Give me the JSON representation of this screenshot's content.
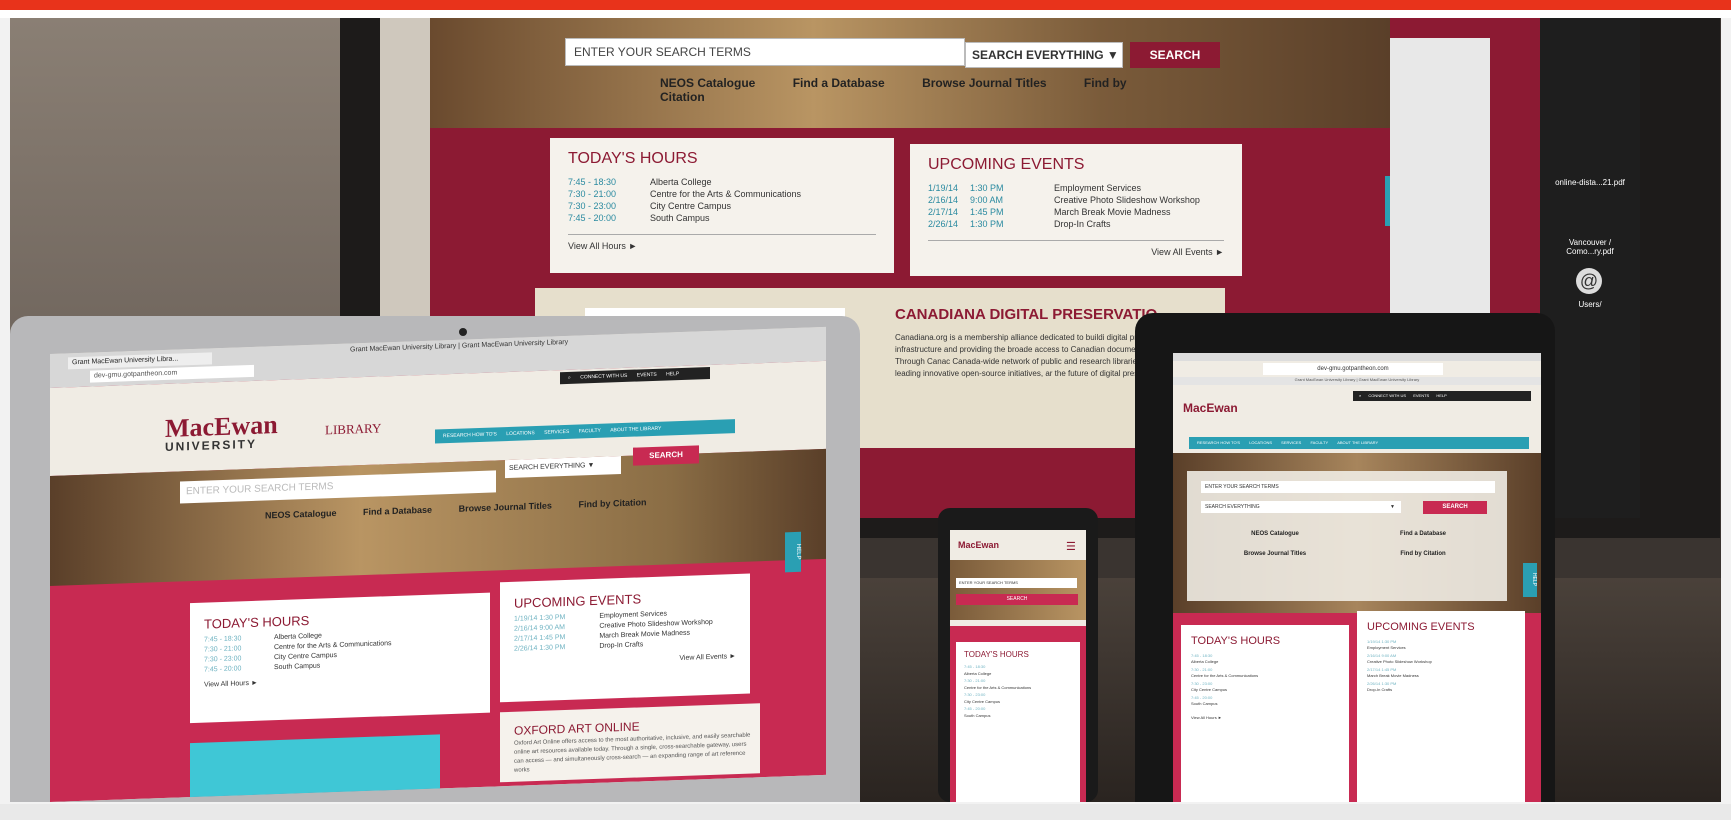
{
  "monitor": {
    "search_placeholder": "ENTER YOUR SEARCH TERMS",
    "search_scope": "SEARCH EVERYTHING",
    "search_button": "SEARCH",
    "links": [
      "NEOS Catalogue",
      "Find a Database",
      "Browse Journal Titles",
      "Find by Citation"
    ],
    "hours_title": "TODAY'S HOURS",
    "hours": [
      {
        "time": "7:45 - 18:30",
        "place": "Alberta College"
      },
      {
        "time": "7:30 - 21:00",
        "place": "Centre for the Arts & Communications"
      },
      {
        "time": "7:30 - 23:00",
        "place": "City Centre Campus"
      },
      {
        "time": "7:45 - 20:00",
        "place": "South Campus"
      }
    ],
    "hours_more": "View All Hours ►",
    "events_title": "UPCOMING EVENTS",
    "events": [
      {
        "date": "1/19/14",
        "time": "1:30 PM",
        "name": "Employment Services"
      },
      {
        "date": "2/16/14",
        "time": "9:00 AM",
        "name": "Creative Photo Slideshow Workshop"
      },
      {
        "date": "2/17/14",
        "time": "1:45 PM",
        "name": "March Break Movie Madness"
      },
      {
        "date": "2/26/14",
        "time": "1:30 PM",
        "name": "Drop-In Crafts"
      }
    ],
    "events_more": "View All Events ►",
    "help_tab": "HELP",
    "feature_title": "CANADIANA DIGITAL PRESERVATIO",
    "feature_text": "Canadiana.org is a membership alliance dedicated to buildi digital preservation infrastructure and providing the broade access to Canadian documentary heritage. Through Canac Canada-wide network of public and research libraries are and capacity, leading innovative open-source initiatives, ar the future of digital preservation in Canada."
  },
  "laptop": {
    "window_title": "Grant MacEwan University Library | Grant MacEwan University Library",
    "tab_label": "Grant MacEwan University Libra...",
    "url": "dev-gmu.gotpantheon.com",
    "logo_main": "MacEwan",
    "logo_sub": "UNIVERSITY",
    "library_label": "LIBRARY",
    "utility_nav": [
      "CONNECT WITH US",
      "EVENTS",
      "HELP"
    ],
    "main_nav": [
      "RESEARCH HOW TO'S",
      "LOCATIONS",
      "SERVICES",
      "FACULTY",
      "ABOUT THE LIBRARY"
    ],
    "search_placeholder": "ENTER YOUR SEARCH TERMS",
    "search_scope": "SEARCH EVERYTHING",
    "search_button": "SEARCH",
    "links": [
      "NEOS Catalogue",
      "Find a Database",
      "Browse Journal Titles",
      "Find by Citation"
    ],
    "hours_title": "TODAY'S HOURS",
    "hours": [
      {
        "time": "7:45 - 18:30",
        "place": "Alberta College"
      },
      {
        "time": "7:30 - 21:00",
        "place": "Centre for the Arts & Communications"
      },
      {
        "time": "7:30 - 23:00",
        "place": "City Centre Campus"
      },
      {
        "time": "7:45 - 20:00",
        "place": "South Campus"
      }
    ],
    "hours_more": "View All Hours ►",
    "events_title": "UPCOMING EVENTS",
    "events": [
      {
        "date": "1/19/14",
        "time": "1:30 PM",
        "name": "Employment Services"
      },
      {
        "date": "2/16/14",
        "time": "9:00 AM",
        "name": "Creative Photo Slideshow Workshop"
      },
      {
        "date": "2/17/14",
        "time": "1:45 PM",
        "name": "March Break Movie Madness"
      },
      {
        "date": "2/26/14",
        "time": "1:30 PM",
        "name": "Drop-In Crafts"
      }
    ],
    "events_more": "View All Events ►",
    "help_tab": "HELP",
    "feature_title": "OXFORD ART ONLINE",
    "feature_text": "Oxford Art Online offers access to the most authoritative, inclusive, and easily searchable online art resources available today. Through a single, cross-searchable gateway, users can access — and simultaneously cross-search — an expanding range of art reference works"
  },
  "phone": {
    "logo": "MacEwan",
    "search_placeholder": "ENTER YOUR SEARCH TERMS",
    "search_button": "SEARCH",
    "hours_title": "TODAY'S HOURS",
    "hours": [
      {
        "time": "7:45 - 18:30",
        "place": "Alberta College"
      },
      {
        "time": "7:30 - 21:00",
        "place": "Centre for the Arts & Communications"
      },
      {
        "time": "7:30 - 23:00",
        "place": "City Centre Campus"
      },
      {
        "time": "7:45 - 20:00",
        "place": "South Campus"
      }
    ]
  },
  "tablet": {
    "url": "dev-gmu.gotpantheon.com",
    "page_title": "Grant MacEwan University Library | Grant MacEwan University Library",
    "logo": "MacEwan",
    "utility_nav": [
      "CONNECT WITH US",
      "EVENTS",
      "HELP"
    ],
    "main_nav": [
      "RESEARCH HOW TO'S",
      "LOCATIONS",
      "SERVICES",
      "FACULTY",
      "ABOUT THE LIBRARY"
    ],
    "search_placeholder": "ENTER YOUR SEARCH TERMS",
    "search_scope": "SEARCH EVERYTHING",
    "search_button": "SEARCH",
    "links": [
      "NEOS Catalogue",
      "Find a Database",
      "Browse Journal Titles",
      "Find by Citation"
    ],
    "hours_title": "TODAY'S HOURS",
    "hours": [
      {
        "time": "7:45 - 18:30",
        "place": "Alberta College"
      },
      {
        "time": "7:30 - 21:00",
        "place": "Centre for the Arts & Communications"
      },
      {
        "time": "7:30 - 23:00",
        "place": "City Centre Campus"
      },
      {
        "time": "7:45 - 20:00",
        "place": "South Campus"
      }
    ],
    "hours_more": "View All Hours ►",
    "events_title": "UPCOMING EVENTS",
    "events": [
      {
        "date": "1/19/14",
        "time": "1:30 PM",
        "name": "Employment Services"
      },
      {
        "date": "2/16/14",
        "time": "9:00 AM",
        "name": "Creative Photo Slideshow Workshop"
      },
      {
        "date": "2/17/14",
        "time": "1:45 PM",
        "name": "March Break Movie Madness"
      },
      {
        "date": "2/26/14",
        "time": "1:30 PM",
        "name": "Drop-In Crafts"
      }
    ],
    "help_tab": "HELP"
  },
  "desktop_icons": [
    "online-dista...21.pdf",
    "Vancouver / Como...ry.pdf",
    "Users/"
  ],
  "colors": {
    "accent_red": "#e8331b",
    "brand_maroon": "#8c1a33",
    "teal": "#2a9fb3",
    "pink": "#c82a52"
  }
}
